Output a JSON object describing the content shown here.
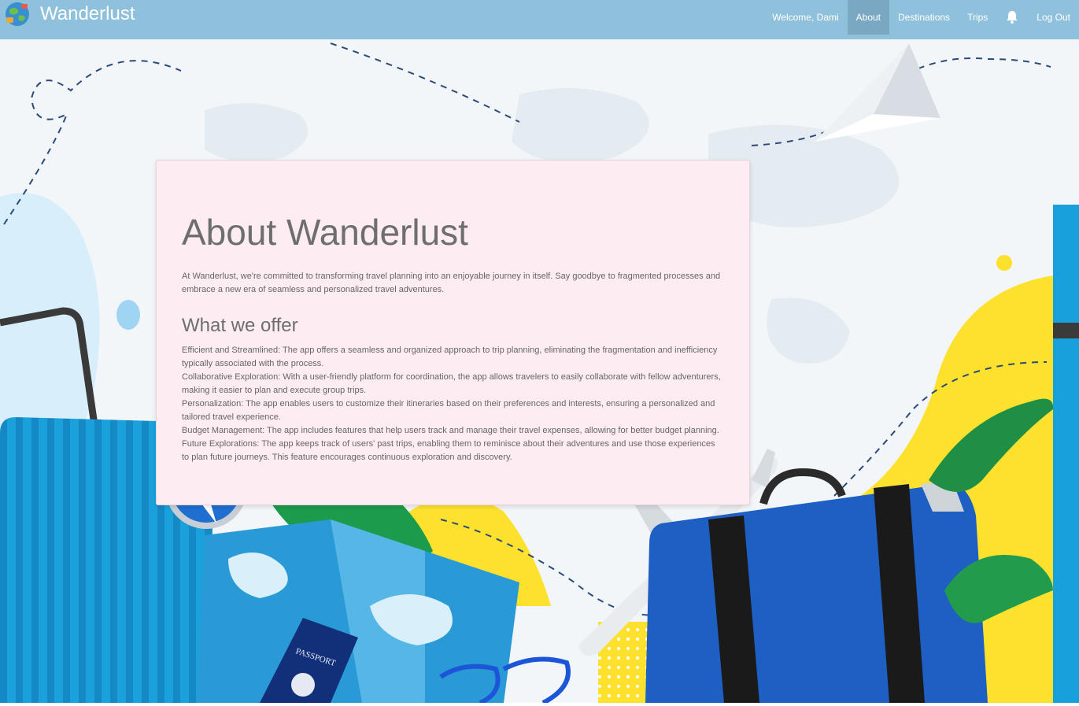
{
  "app": {
    "name": "Wanderlust"
  },
  "nav": {
    "welcome": "Welcome, Dami",
    "links": [
      "About",
      "Destinations",
      "Trips"
    ],
    "active": "About",
    "logout": "Log Out",
    "notifications_icon": "bell-icon"
  },
  "about": {
    "title": "About Wanderlust",
    "intro": "At Wanderlust, we're committed to transforming travel planning into an enjoyable journey in itself. Say goodbye to fragmented processes and embrace a new era of seamless and personalized travel adventures.",
    "offer_heading": "What we offer",
    "offers": [
      "Efficient and Streamlined: The app offers a seamless and organized approach to trip planning, eliminating the fragmentation and inefficiency typically associated with the process.",
      "Collaborative Exploration: With a user-friendly platform for coordination, the app allows travelers to easily collaborate with fellow adventurers, making it easier to plan and execute group trips.",
      "Personalization: The app enables users to customize their itineraries based on their preferences and interests, ensuring a personalized and tailored travel experience.",
      "Budget Management: The app includes features that help users track and manage their travel expenses, allowing for better budget planning.",
      "Future Explorations: The app keeps track of users' past trips, enabling them to reminisce about their adventures and use those experiences to plan future journeys. This feature encourages continuous exploration and discovery."
    ]
  },
  "background": {
    "passport_text": "PASSPORT",
    "colors": {
      "navbar": "#90c1dc",
      "nav_active": "#7aa8c2",
      "card": "#fdecf1",
      "yellow": "#fde12d",
      "blue": "#1a9fd8",
      "suitcase": "#1d5fc2"
    }
  }
}
